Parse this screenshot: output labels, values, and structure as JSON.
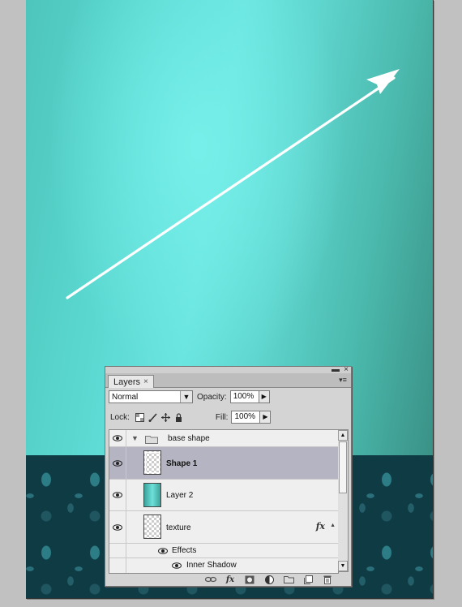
{
  "panel": {
    "tab_label": "Layers",
    "tab_close": "×",
    "minimize": "▬",
    "close": "×",
    "menu": "▾≡"
  },
  "blend": {
    "mode": "Normal",
    "dropdown_glyph": "▼"
  },
  "opacity": {
    "label": "Opacity:",
    "value": "100%",
    "button_glyph": "▶"
  },
  "lock": {
    "label": "Lock:"
  },
  "fill": {
    "label": "Fill:",
    "value": "100%",
    "button_glyph": "▶"
  },
  "layers": [
    {
      "name": "base shape",
      "type": "group"
    },
    {
      "name": "Shape 1",
      "type": "shape",
      "selected": true
    },
    {
      "name": "Layer 2",
      "type": "layer"
    },
    {
      "name": "texture",
      "type": "layer",
      "fx": "fx"
    },
    {
      "name": "Effects",
      "type": "effects"
    },
    {
      "name": "Inner Shadow",
      "type": "effect"
    }
  ],
  "scroll": {
    "up": "▲",
    "down": "▼"
  },
  "icons": {
    "link": "link-icon",
    "fx": "fx-icon",
    "mask": "mask-icon",
    "adjustment": "adjustment-icon",
    "folder": "folder-icon",
    "new_layer": "new-layer-icon",
    "trash": "trash-icon"
  },
  "bottom_fx_label": "fx",
  "colors": {
    "canvas_bg": "#c1c1c1",
    "gradient_light": "#6ae4df",
    "gradient_dark": "#3a9186",
    "damask": "#0f3b44",
    "selected_row": "#b4b4c2"
  }
}
